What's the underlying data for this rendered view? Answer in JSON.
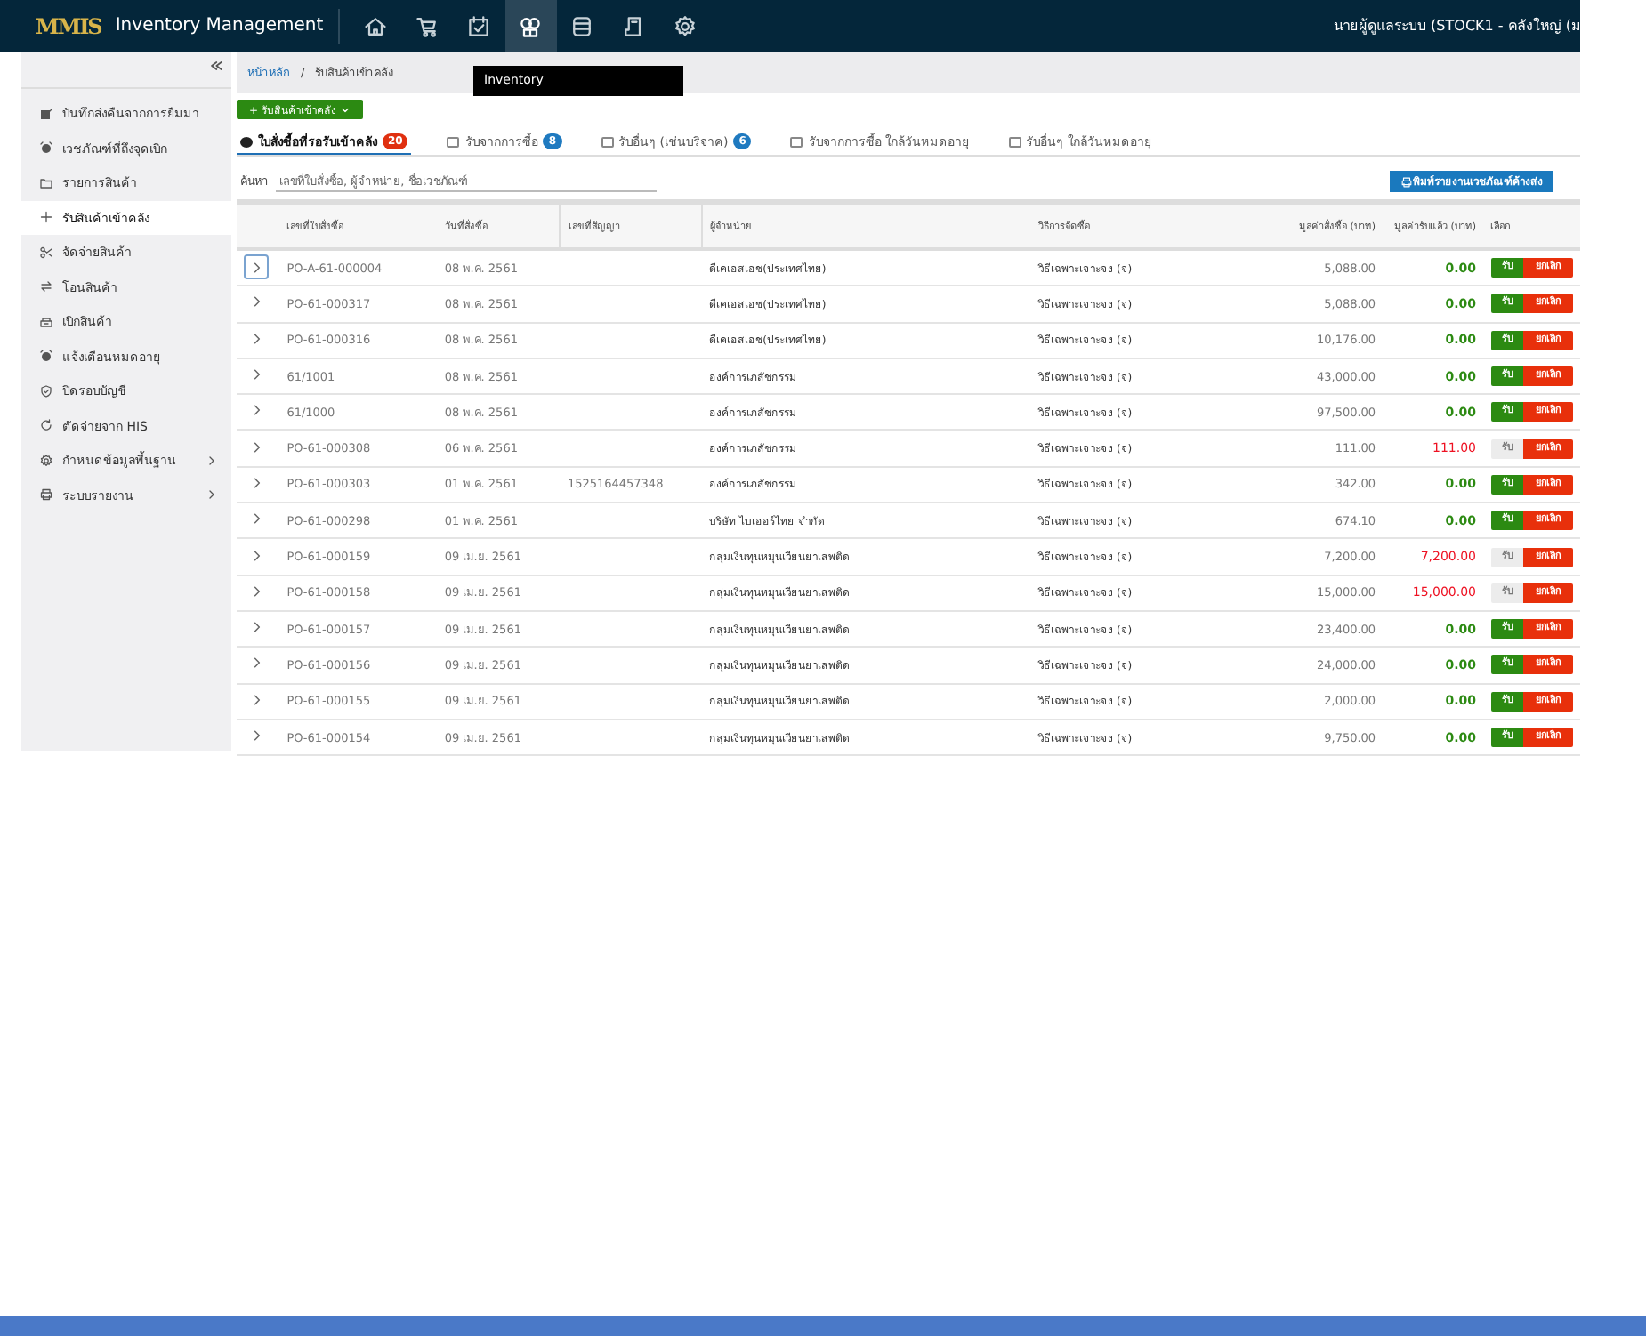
{
  "app": {
    "title": "Inventory Management",
    "logo": "MMIS",
    "user": "นายผู้ดูแลระบบ (STOCK1 - คลังใหญ่ (ม"
  },
  "nav": [
    {
      "kind": "home",
      "selected": false
    },
    {
      "kind": "cart",
      "selected": false
    },
    {
      "kind": "calendar",
      "selected": false
    },
    {
      "kind": "boxes",
      "selected": true
    },
    {
      "kind": "database",
      "selected": false
    },
    {
      "kind": "document",
      "selected": false
    },
    {
      "kind": "gear",
      "selected": false
    }
  ],
  "tooltip": "Inventory",
  "sidebar": {
    "items": [
      {
        "label": "บันทึกส่งคืนจากการยืมมา",
        "kind": "edit",
        "selected": false,
        "submenu": false
      },
      {
        "label": "เวชภัณฑ์ที่ถึงจุดเบิก",
        "kind": "alarm",
        "selected": false,
        "submenu": false
      },
      {
        "label": "รายการสินค้า",
        "kind": "folder",
        "selected": false,
        "submenu": false
      },
      {
        "label": "รับสินค้าเข้าคลัง",
        "kind": "plus",
        "selected": true,
        "submenu": false
      },
      {
        "label": "จัดจ่ายสินค้า",
        "kind": "scissors",
        "selected": false,
        "submenu": false
      },
      {
        "label": "โอนสินค้า",
        "kind": "transfer",
        "selected": false,
        "submenu": false
      },
      {
        "label": "เบิกสินค้า",
        "kind": "box",
        "selected": false,
        "submenu": false
      },
      {
        "label": "แจ้งเตือนหมดอายุ",
        "kind": "alarm",
        "selected": false,
        "submenu": false
      },
      {
        "label": "ปิดรอบบัญชี",
        "kind": "shield",
        "selected": false,
        "submenu": false
      },
      {
        "label": "ตัดจ่ายจาก HIS",
        "kind": "refresh",
        "selected": false,
        "submenu": false
      },
      {
        "label": "กำหนดข้อมูลพื้นฐาน",
        "kind": "gear",
        "selected": false,
        "submenu": true
      },
      {
        "label": "ระบบรายงาน",
        "kind": "print",
        "selected": false,
        "submenu": true
      }
    ]
  },
  "breadcrumb": [
    {
      "label": "หน้าหลัก",
      "link": true
    },
    {
      "label": "/",
      "link": false
    },
    {
      "label": "รับสินค้าเข้าคลัง",
      "link": false
    }
  ],
  "add_button": "+ รับสินค้าเข้าคลัง",
  "tabs": [
    {
      "label": "ใบสั่งซื้อที่รอรับเข้าคลัง",
      "badge": "20",
      "color": "#e03010",
      "selected": true
    },
    {
      "label": "รับจากการซื้อ",
      "badge": "8",
      "color": "#1f7ac0",
      "selected": false
    },
    {
      "label": "รับอื่นๆ (เช่นบริจาค)",
      "badge": "6",
      "color": "#1f7ac0",
      "selected": false
    },
    {
      "label": "รับจากการซื้อ ใกล้วันหมดอายุ",
      "selected": false
    },
    {
      "label": "รับอื่นๆ ใกล้วันหมดอายุ",
      "selected": false
    }
  ],
  "search": {
    "label": "ค้นหา",
    "placeholder": "เลขที่ใบสั่งซื้อ, ผู้จำหน่าย, ชื่อเวชภัณฑ์"
  },
  "print_button": "พิมพ์รายงานเวชภัณฑ์ค้างส่ง",
  "table": {
    "columns": [
      "เลขที่ใบสั่งซื้อ",
      "วันที่สั่งซื้อ",
      "เลขที่สัญญา",
      "ผู้จำหน่าย",
      "วิธีการจัดซื้อ",
      "มูลค่าสั่งซื้อ (บาท)",
      "มูลค่ารับแล้ว (บาท)",
      "เลือก"
    ],
    "rows": [
      {
        "po": "PO-A-61-000004",
        "date": "08 พ.ค. 2561",
        "vendor": "ดีเคเอสเอช(ประเทศไทย)",
        "method": "วิธีเฉพาะเจาะจง (จ)",
        "ordered": "5,088.00",
        "received": "0.00",
        "receive_label": "รับ",
        "cancel_label": "ยกเลิก",
        "receivable": true,
        "selected": true
      },
      {
        "po": "PO-61-000317",
        "date": "08 พ.ค. 2561",
        "vendor": "ดีเคเอสเอช(ประเทศไทย)",
        "method": "วิธีเฉพาะเจาะจง (จ)",
        "ordered": "5,088.00",
        "received": "0.00",
        "receive_label": "รับ",
        "cancel_label": "ยกเลิก",
        "receivable": true,
        "selected": false
      },
      {
        "po": "PO-61-000316",
        "date": "08 พ.ค. 2561",
        "vendor": "ดีเคเอสเอช(ประเทศไทย)",
        "method": "วิธีเฉพาะเจาะจง (จ)",
        "ordered": "10,176.00",
        "received": "0.00",
        "receive_label": "รับ",
        "cancel_label": "ยกเลิก",
        "receivable": true,
        "selected": false
      },
      {
        "po": "61/1001",
        "date": "08 พ.ค. 2561",
        "vendor": "องค์การเภสัชกรรม",
        "method": "วิธีเฉพาะเจาะจง (จ)",
        "ordered": "43,000.00",
        "received": "0.00",
        "receive_label": "รับ",
        "cancel_label": "ยกเลิก",
        "receivable": true,
        "selected": false
      },
      {
        "po": "61/1000",
        "date": "08 พ.ค. 2561",
        "vendor": "องค์การเภสัชกรรม",
        "method": "วิธีเฉพาะเจาะจง (จ)",
        "ordered": "97,500.00",
        "received": "0.00",
        "receive_label": "รับ",
        "cancel_label": "ยกเลิก",
        "receivable": true,
        "selected": false
      },
      {
        "po": "PO-61-000308",
        "date": "06 พ.ค. 2561",
        "vendor": "องค์การเภสัชกรรม",
        "method": "วิธีเฉพาะเจาะจง (จ)",
        "ordered": "111.00",
        "received": "111.00",
        "receive_label": "รับ",
        "cancel_label": "ยกเลิก",
        "receivable": false,
        "selected": false
      },
      {
        "po": "PO-61-000303",
        "date": "01 พ.ค. 2561",
        "contract": "1525164457348",
        "vendor": "องค์การเภสัชกรรม",
        "method": "วิธีเฉพาะเจาะจง (จ)",
        "ordered": "342.00",
        "received": "0.00",
        "receive_label": "รับ",
        "cancel_label": "ยกเลิก",
        "receivable": true,
        "selected": false
      },
      {
        "po": "PO-61-000298",
        "date": "01 พ.ค. 2561",
        "vendor": "บริษัท ไบเออร์ไทย จำกัด",
        "method": "วิธีเฉพาะเจาะจง (จ)",
        "ordered": "674.10",
        "received": "0.00",
        "receive_label": "รับ",
        "cancel_label": "ยกเลิก",
        "receivable": true,
        "selected": false
      },
      {
        "po": "PO-61-000159",
        "date": "09 เม.ย. 2561",
        "vendor": "กลุ่มเงินทุนหมุนเวียนยาเสพติด",
        "method": "วิธีเฉพาะเจาะจง (จ)",
        "ordered": "7,200.00",
        "received": "7,200.00",
        "receive_label": "รับ",
        "cancel_label": "ยกเลิก",
        "receivable": false,
        "selected": false
      },
      {
        "po": "PO-61-000158",
        "date": "09 เม.ย. 2561",
        "vendor": "กลุ่มเงินทุนหมุนเวียนยาเสพติด",
        "method": "วิธีเฉพาะเจาะจง (จ)",
        "ordered": "15,000.00",
        "received": "15,000.00",
        "receive_label": "รับ",
        "cancel_label": "ยกเลิก",
        "receivable": false,
        "selected": false
      },
      {
        "po": "PO-61-000157",
        "date": "09 เม.ย. 2561",
        "vendor": "กลุ่มเงินทุนหมุนเวียนยาเสพติด",
        "method": "วิธีเฉพาะเจาะจง (จ)",
        "ordered": "23,400.00",
        "received": "0.00",
        "receive_label": "รับ",
        "cancel_label": "ยกเลิก",
        "receivable": true,
        "selected": false
      },
      {
        "po": "PO-61-000156",
        "date": "09 เม.ย. 2561",
        "vendor": "กลุ่มเงินทุนหมุนเวียนยาเสพติด",
        "method": "วิธีเฉพาะเจาะจง (จ)",
        "ordered": "24,000.00",
        "received": "0.00",
        "receive_label": "รับ",
        "cancel_label": "ยกเลิก",
        "receivable": true,
        "selected": false
      },
      {
        "po": "PO-61-000155",
        "date": "09 เม.ย. 2561",
        "vendor": "กลุ่มเงินทุนหมุนเวียนยาเสพติด",
        "method": "วิธีเฉพาะเจาะจง (จ)",
        "ordered": "2,000.00",
        "received": "0.00",
        "receive_label": "รับ",
        "cancel_label": "ยกเลิก",
        "receivable": true,
        "selected": false
      },
      {
        "po": "PO-61-000154",
        "date": "09 เม.ย. 2561",
        "vendor": "กลุ่มเงินทุนหมุนเวียนยาเสพติด",
        "method": "วิธีเฉพาะเจาะจง (จ)",
        "ordered": "9,750.00",
        "received": "0.00",
        "receive_label": "รับ",
        "cancel_label": "ยกเลิก",
        "receivable": true,
        "selected": false
      }
    ]
  }
}
